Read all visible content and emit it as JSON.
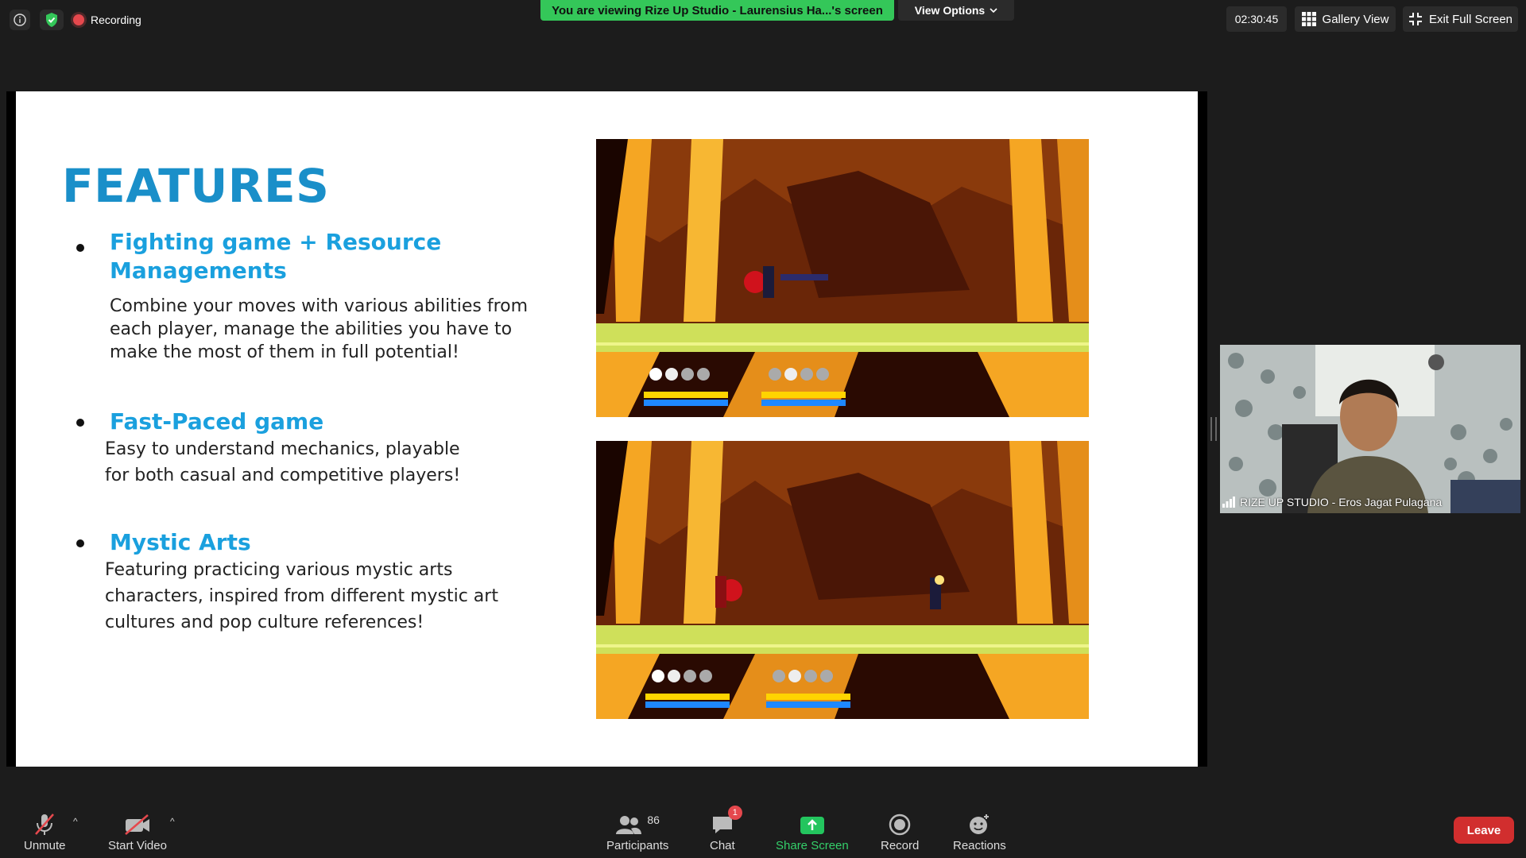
{
  "topbar": {
    "recording_label": "Recording",
    "viewing_banner": "You are viewing Rize Up Studio - Laurensius Ha...'s screen",
    "view_options_label": "View Options",
    "timer": "02:30:45",
    "gallery_view_label": "Gallery View",
    "exit_fullscreen_label": "Exit Full Screen"
  },
  "slide": {
    "title": "FEATURES",
    "features": [
      {
        "heading": "Fighting game + Resource Managements",
        "description": "Combine your moves with various abilities  from each player, manage the abilities you  have to make the most of them in full  potential!"
      },
      {
        "heading": "Fast-Paced game",
        "description": "Easy to understand mechanics, playable for both casual and competitive players!"
      },
      {
        "heading": "Mystic Arts",
        "description": "Featuring practicing various mystic arts characters, inspired from different mystic art cultures and pop culture references!"
      }
    ]
  },
  "video": {
    "participant_name": "RIZE UP STUDIO - Eros Jagat Pulagana"
  },
  "bottombar": {
    "unmute_label": "Unmute",
    "start_video_label": "Start Video",
    "participants_label": "Participants",
    "participants_count": "86",
    "chat_label": "Chat",
    "chat_badge": "1",
    "share_screen_label": "Share Screen",
    "record_label": "Record",
    "reactions_label": "Reactions",
    "leave_label": "Leave"
  },
  "colors": {
    "banner_green": "#34c759",
    "leave_red": "#d12e2e",
    "slide_heading_blue": "#1aa0de",
    "slide_title_blue": "#1a8fc9"
  }
}
